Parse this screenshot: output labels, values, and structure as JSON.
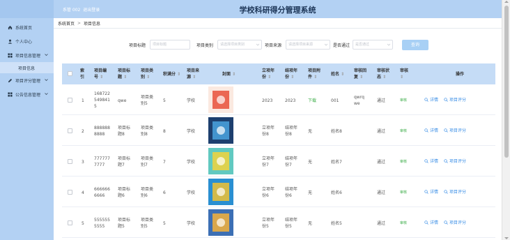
{
  "app": {
    "title": "学校科研得分管理系统",
    "user_line": "系管 002",
    "logout": "退出登录"
  },
  "sidebar": {
    "items": [
      {
        "label": "系统首页",
        "icon": "home-icon"
      },
      {
        "label": "个人中心",
        "icon": "user-icon"
      },
      {
        "label": "项目信息管理",
        "icon": "grid-icon"
      },
      {
        "label": "项目评分管理",
        "icon": "pen-icon"
      },
      {
        "label": "公告信息管理",
        "icon": "grid-icon"
      }
    ],
    "sub_items": [
      "项目信息"
    ]
  },
  "breadcrumb": {
    "home": "系统首页",
    "sep": ">",
    "current": "项目信息"
  },
  "search": {
    "title_label": "项目标题",
    "title_placeholder": "项目标题",
    "category_label": "项目类别",
    "category_placeholder": "请选择项目类别",
    "source_label": "项目来源",
    "source_placeholder": "请选择项目来源",
    "pass_label": "是否通过",
    "pass_placeholder": "是否通过",
    "button": "查询"
  },
  "table": {
    "headers": {
      "index": "索",
      "index2": "引",
      "number1": "项目编",
      "number2": "号",
      "title1": "项目标",
      "title2": "题",
      "cat1": "项目类",
      "cat2": "别",
      "score1": "积满分",
      "source1": "项目来",
      "source2": "源",
      "cover": "封面",
      "year1": "立项年",
      "year2": "份",
      "done1": "结项年",
      "done2": "份",
      "file1": "项目附",
      "file2": "件",
      "name": "姓名",
      "reply1": "审核回",
      "reply2": "复",
      "status1": "审核状",
      "status2": "态",
      "audit": "审核",
      "ops": "操作",
      "sort": "⇕"
    },
    "rows": [
      {
        "index": "1",
        "number": [
          "168722",
          "549841",
          "5"
        ],
        "title": [
          "qwe"
        ],
        "cat": [
          "项目类",
          "别5"
        ],
        "score": "5",
        "source": "学校",
        "year": [
          "2023"
        ],
        "done": [
          "2023"
        ],
        "file": "下载",
        "file_is_link": true,
        "name": "001",
        "reply": [
          "qwrq",
          "we"
        ],
        "status": "通过",
        "audit": "审核"
      },
      {
        "index": "2",
        "number": [
          "888888",
          "8888"
        ],
        "title": [
          "项目标",
          "题8"
        ],
        "cat": [
          "项目类",
          "别8"
        ],
        "score": "8",
        "source": "学校",
        "year": [
          "立项年",
          "份8"
        ],
        "done": [
          "结项年",
          "份8"
        ],
        "file": "无",
        "file_is_link": false,
        "name": "姓名8",
        "reply": [],
        "status": "通过",
        "audit": "审核"
      },
      {
        "index": "3",
        "number": [
          "777777",
          "7777"
        ],
        "title": [
          "项目标",
          "题7"
        ],
        "cat": [
          "项目类",
          "别7"
        ],
        "score": "7",
        "source": "学校",
        "year": [
          "立项年",
          "份7"
        ],
        "done": [
          "结项年",
          "份7"
        ],
        "file": "无",
        "file_is_link": false,
        "name": "姓名7",
        "reply": [],
        "status": "通过",
        "audit": "审核"
      },
      {
        "index": "4",
        "number": [
          "666666",
          "6666"
        ],
        "title": [
          "项目标",
          "题6"
        ],
        "cat": [
          "项目类",
          "别6"
        ],
        "score": "6",
        "source": "学校",
        "year": [
          "立项年",
          "份6"
        ],
        "done": [
          "结项年",
          "份6"
        ],
        "file": "无",
        "file_is_link": false,
        "name": "姓名6",
        "reply": [],
        "status": "通过",
        "audit": "审核"
      },
      {
        "index": "5",
        "number": [
          "555555",
          "5555"
        ],
        "title": [
          "项目标",
          "题5"
        ],
        "cat": [
          "项目类",
          "别5"
        ],
        "score": "5",
        "source": "学校",
        "year": [
          "立项年",
          "份5"
        ],
        "done": [
          "结项年",
          "份5"
        ],
        "file": "无",
        "file_is_link": false,
        "name": "姓名5",
        "reply": [],
        "status": "通过",
        "audit": "审核"
      }
    ],
    "actions": {
      "detail": "详情",
      "evaluate": "项目评分"
    }
  },
  "colors": {
    "sidebar": "#b3d1f3",
    "header_row": "#c5dcf6",
    "link": "#3a8ee6",
    "green": "#3fae4b",
    "button": "#a8d0f5"
  }
}
